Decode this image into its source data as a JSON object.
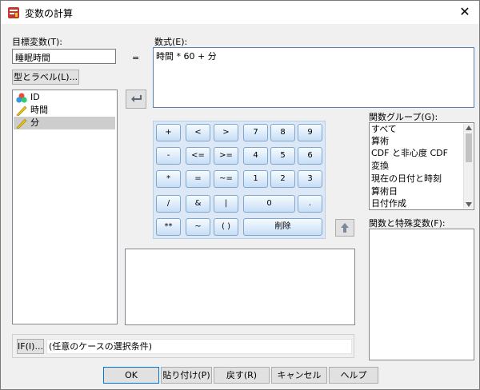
{
  "window": {
    "title": "変数の計算",
    "close_glyph": "✕"
  },
  "target": {
    "label": "目標変数(T):",
    "value": "睡眠時間",
    "type_label_button": "型とラベル(L)..."
  },
  "equals_sign": "=",
  "expression": {
    "label": "数式(E):",
    "value": "時間 * 60 + 分"
  },
  "variables": [
    {
      "name": "ID",
      "icon": "nominal-icon"
    },
    {
      "name": "時間",
      "icon": "scale-icon"
    },
    {
      "name": "分",
      "icon": "scale-icon",
      "selected": true
    }
  ],
  "keypad": {
    "rows": [
      [
        "+",
        "<",
        ">",
        "7",
        "8",
        "9"
      ],
      [
        "-",
        "<=",
        ">=",
        "4",
        "5",
        "6"
      ],
      [
        "*",
        "=",
        "~=",
        "1",
        "2",
        "3"
      ],
      [
        "/",
        "&",
        "|",
        "0",
        "."
      ],
      [
        "**",
        "~",
        "( )",
        "削除"
      ]
    ]
  },
  "function_group": {
    "label": "関数グループ(G):",
    "items": [
      "すべて",
      "算術",
      "CDF と非心度 CDF",
      "変換",
      "現在の日付と時刻",
      "算術日",
      "日付作成"
    ]
  },
  "functions": {
    "label": "関数と特殊変数(F):"
  },
  "condition": {
    "if_button": "IF(I)...",
    "text": "(任意のケースの選択条件)"
  },
  "buttons": {
    "ok": "OK",
    "paste": "貼り付け(P)",
    "reset": "戻す(R)",
    "cancel": "キャンセル",
    "help": "ヘルプ"
  }
}
